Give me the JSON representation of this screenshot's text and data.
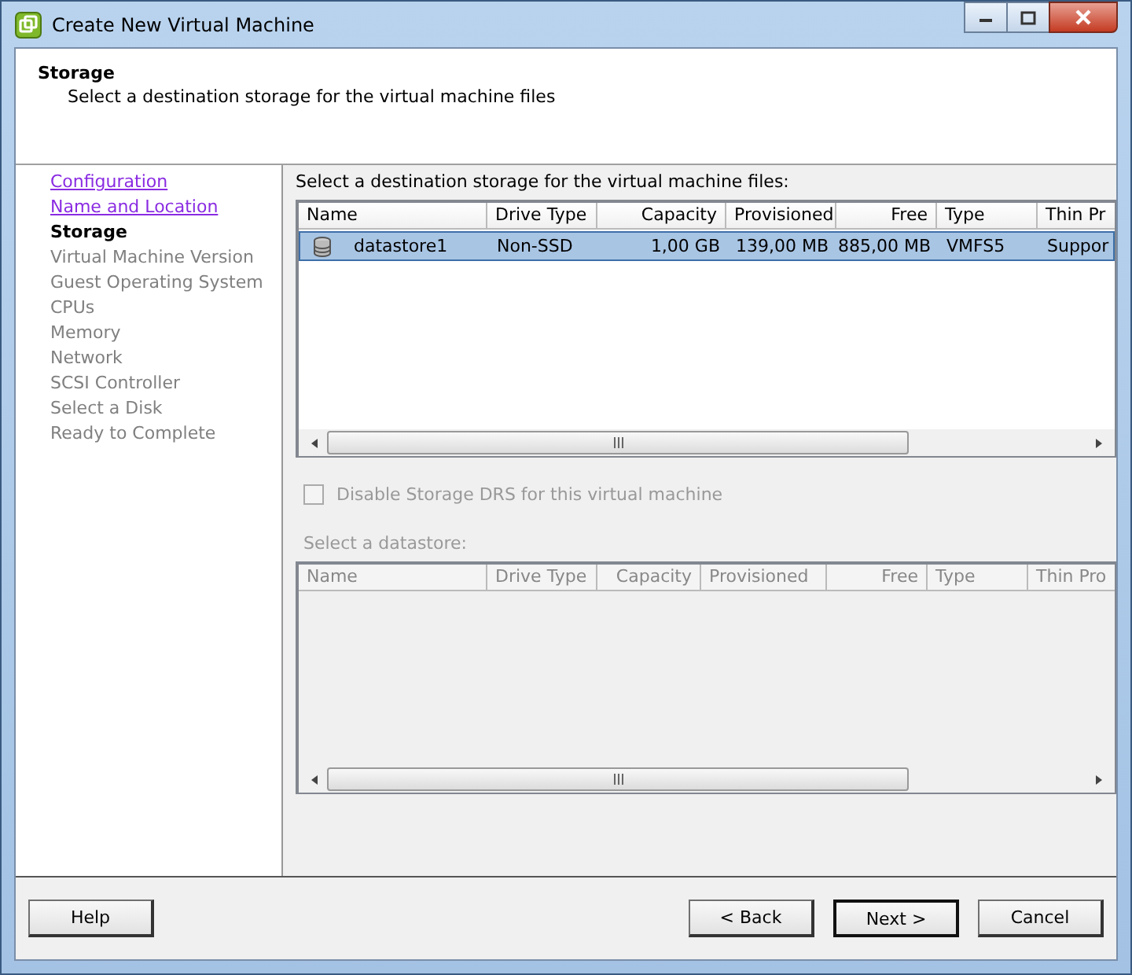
{
  "window": {
    "title": "Create New Virtual Machine"
  },
  "header": {
    "title": "Storage",
    "subtitle": "Select a destination storage for the virtual machine files"
  },
  "steps": [
    {
      "label": "Configuration",
      "visited": true,
      "current": false
    },
    {
      "label": "Name and Location",
      "visited": true,
      "current": false
    },
    {
      "label": "Storage",
      "visited": false,
      "current": true
    },
    {
      "label": "Virtual Machine Version",
      "visited": false,
      "current": false
    },
    {
      "label": "Guest Operating System",
      "visited": false,
      "current": false
    },
    {
      "label": "CPUs",
      "visited": false,
      "current": false
    },
    {
      "label": "Memory",
      "visited": false,
      "current": false
    },
    {
      "label": "Network",
      "visited": false,
      "current": false
    },
    {
      "label": "SCSI Controller",
      "visited": false,
      "current": false
    },
    {
      "label": "Select a Disk",
      "visited": false,
      "current": false
    },
    {
      "label": "Ready to Complete",
      "visited": false,
      "current": false
    }
  ],
  "storage_table": {
    "caption": "Select a destination storage for the virtual machine files:",
    "disabled": false,
    "columns": [
      {
        "label": "Name",
        "numeric": false
      },
      {
        "label": "Drive Type",
        "numeric": false
      },
      {
        "label": "Capacity",
        "numeric": true
      },
      {
        "label": "Provisioned",
        "numeric": false
      },
      {
        "label": "Free",
        "numeric": true
      },
      {
        "label": "Type",
        "numeric": false
      },
      {
        "label": "Thin Pr",
        "numeric": false
      }
    ],
    "rows": [
      {
        "selected": true,
        "cells": [
          "datastore1",
          "Non-SSD",
          "1,00 GB",
          "139,00 MB",
          "885,00 MB",
          "VMFS5",
          "Suppor"
        ]
      }
    ]
  },
  "drs_checkbox": {
    "label": "Disable Storage DRS for this virtual machine",
    "checked": false,
    "disabled": true
  },
  "datastore_table": {
    "caption": "Select a datastore:",
    "disabled": true,
    "columns": [
      {
        "label": "Name",
        "numeric": false
      },
      {
        "label": "Drive Type",
        "numeric": false
      },
      {
        "label": "Capacity",
        "numeric": true
      },
      {
        "label": "Provisioned",
        "numeric": false
      },
      {
        "label": "Free",
        "numeric": true
      },
      {
        "label": "Type",
        "numeric": false
      },
      {
        "label": "Thin Pro",
        "numeric": false
      }
    ]
  },
  "help_button": {
    "label": "Help"
  },
  "buttons": [
    {
      "label": "< Back",
      "default": false
    },
    {
      "label": "Next >",
      "default": true
    },
    {
      "label": "Cancel",
      "default": false
    }
  ]
}
